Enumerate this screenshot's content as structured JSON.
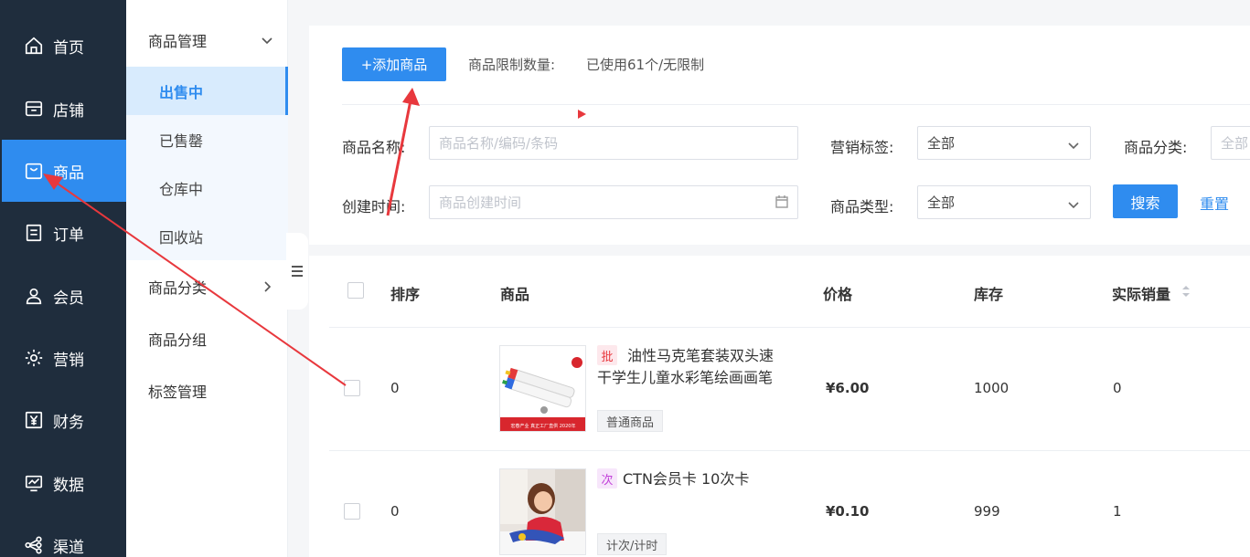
{
  "nav": {
    "items": [
      {
        "label": "首页",
        "icon": "home-icon"
      },
      {
        "label": "店铺",
        "icon": "store-icon"
      },
      {
        "label": "商品",
        "icon": "bag-icon",
        "active": true
      },
      {
        "label": "订单",
        "icon": "order-icon"
      },
      {
        "label": "会员",
        "icon": "user-icon"
      },
      {
        "label": "营销",
        "icon": "gear-icon"
      },
      {
        "label": "财务",
        "icon": "yen-icon"
      },
      {
        "label": "数据",
        "icon": "chart-icon"
      },
      {
        "label": "渠道",
        "icon": "share-icon"
      }
    ]
  },
  "subnav": {
    "group_goods": "商品管理",
    "items": [
      "出售中",
      "已售罄",
      "仓库中",
      "回收站"
    ],
    "category": "商品分类",
    "grouping": "商品分组",
    "tags": "标签管理"
  },
  "toolbar": {
    "add_label": "+添加商品",
    "limit_label": "商品限制数量:",
    "limit_value": "已使用61个/无限制"
  },
  "filters": {
    "name_label": "商品名称:",
    "name_placeholder": "商品名称/编码/条码",
    "marketing_label": "营销标签:",
    "marketing_value": "全部",
    "category_label": "商品分类:",
    "category_value": "全部",
    "created_label": "创建时间:",
    "created_placeholder": "商品创建时间",
    "type_label": "商品类型:",
    "type_value": "全部",
    "search_label": "搜索",
    "reset_label": "重置"
  },
  "table": {
    "headers": {
      "sort": "排序",
      "product": "商品",
      "price": "价格",
      "stock": "库存",
      "sales": "实际销量"
    },
    "rows": [
      {
        "sort": "0",
        "mark": "批",
        "name_line1": "油性马克笔套装双头速",
        "name_line2": "干学生儿童水彩笔绘画画笔",
        "type": "普通商品",
        "price": "¥6.00",
        "stock": "1000",
        "sales": "0",
        "thumb_caption": "宏春产业 真正工厂直供 2020年"
      },
      {
        "sort": "0",
        "mark": "次",
        "name_line1": "CTN会员卡 10次卡",
        "name_line2": "",
        "type": "计次/计时",
        "price": "¥0.10",
        "stock": "999",
        "sales": "1"
      }
    ]
  },
  "colors": {
    "primary": "#2f8cef",
    "nav_bg": "#1f2d3d",
    "annotation": "#e8383d"
  }
}
